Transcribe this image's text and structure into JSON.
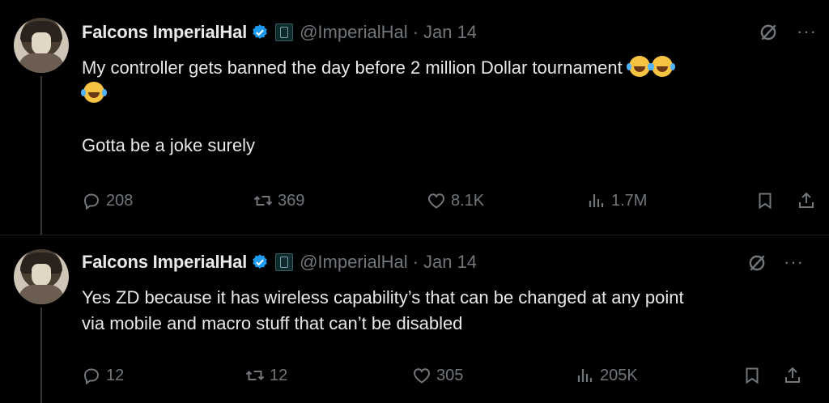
{
  "tweets": [
    {
      "display_name": "Falcons ImperialHal",
      "handle": "@ImperialHal",
      "separator": "·",
      "date": "Jan 14",
      "lines": [
        "My controller gets banned the day before 2 million Dollar tournament",
        "",
        "Gotta be a joke surely"
      ],
      "replies": "208",
      "reposts": "369",
      "likes": "8.1K",
      "views": "1.7M"
    },
    {
      "display_name": "Falcons ImperialHal",
      "handle": "@ImperialHal",
      "separator": "·",
      "date": "Jan 14",
      "lines": [
        "Yes ZD because it has wireless capability’s that can be changed at any point",
        "via mobile and macro stuff that can’t be disabled"
      ],
      "replies": "12",
      "reposts": "12",
      "likes": "305",
      "views": "205K"
    }
  ],
  "icons": {
    "verified": "verified-badge-icon",
    "affiliate": "affiliate-badge-icon",
    "grok": "grok-icon",
    "more": "more-icon",
    "reply": "reply-icon",
    "repost": "repost-icon",
    "like": "like-icon",
    "views": "views-icon",
    "bookmark": "bookmark-icon",
    "share": "share-icon",
    "emoji": "joy-emoji"
  },
  "colors": {
    "background": "#000000",
    "text": "#e7e9ea",
    "muted": "#71767b",
    "verified": "#1d9bf0"
  },
  "more_label": "···"
}
